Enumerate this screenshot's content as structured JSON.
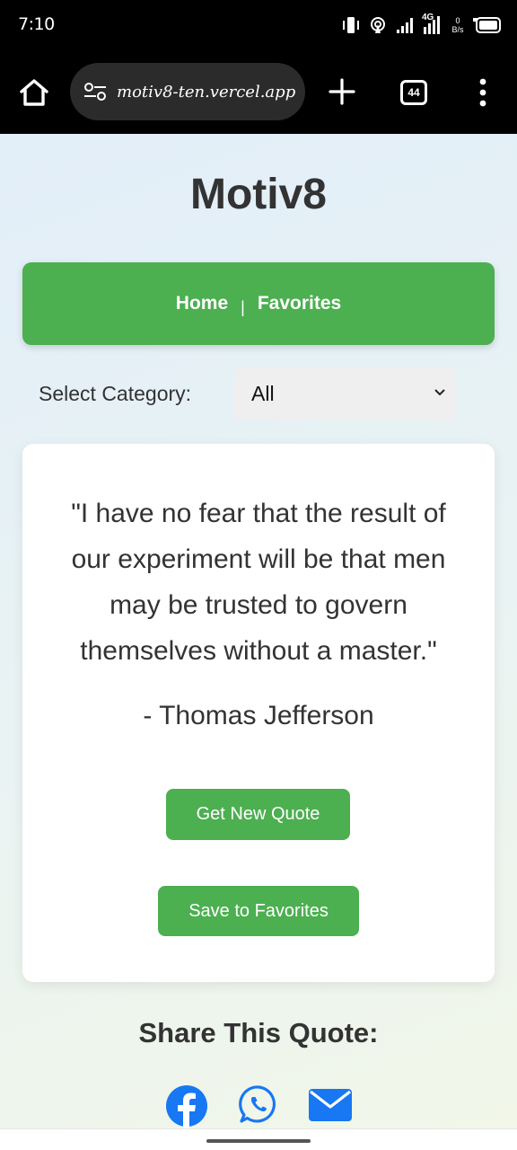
{
  "status_bar": {
    "time": "7:10",
    "network_label": "4G",
    "speed_value": "0",
    "speed_unit": "B/s",
    "icons": [
      "vibrate-icon",
      "hotspot-icon",
      "signal-icon",
      "signal-4g-icon",
      "battery-icon"
    ]
  },
  "browser": {
    "url": "motiv8-ten.vercel.app",
    "tab_count": "44",
    "icons": [
      "home-icon",
      "site-settings-icon",
      "new-tab-icon",
      "tabs-icon",
      "more-menu-icon"
    ]
  },
  "app": {
    "title": "Motiv8",
    "nav": {
      "home_label": "Home",
      "separator": "|",
      "favorites_label": "Favorites"
    },
    "category": {
      "label": "Select Category:",
      "selected": "All"
    },
    "quote": {
      "text": "\"I have no fear that the result of our experiment will be that men may be trusted to govern themselves without a master.\"",
      "author": "- Thomas Jefferson"
    },
    "buttons": {
      "new_quote": "Get New Quote",
      "save_favorites": "Save to Favorites"
    },
    "share": {
      "title": "Share This Quote:",
      "icons": [
        "facebook-icon",
        "whatsapp-icon",
        "email-icon"
      ]
    }
  },
  "colors": {
    "accent_green": "#4caf50",
    "facebook_blue": "#1877f2",
    "text_dark": "#333333"
  }
}
